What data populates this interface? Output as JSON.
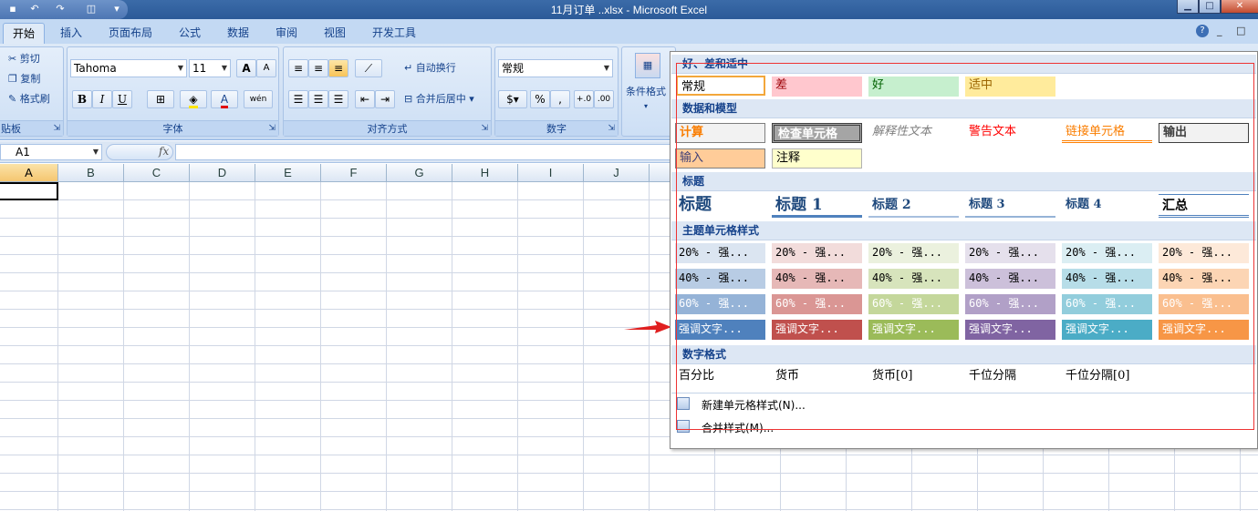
{
  "window": {
    "title": "11月订单 ..xlsx - Microsoft Excel",
    "min": "▁",
    "max": "□",
    "close": "✕"
  },
  "ribbon_tabs": [
    "开始",
    "插入",
    "页面布局",
    "公式",
    "数据",
    "审阅",
    "视图",
    "开发工具"
  ],
  "ribbon_right": {
    "help": "?",
    "min": "_",
    "restore": "□"
  },
  "clipboard": {
    "cut": "剪切",
    "copy": "复制",
    "painter": "格式刷",
    "label": "贴板"
  },
  "font": {
    "name": "Tahoma",
    "size": "11",
    "grow": "A",
    "shrink": "A",
    "bold": "B",
    "italic": "I",
    "underline": "U",
    "phonetic": "wén",
    "label": "字体"
  },
  "alignment": {
    "wrap": "自动换行",
    "merge": "合并后居中",
    "label": "对齐方式"
  },
  "number": {
    "format": "常规",
    "percent": "%",
    "comma": ",",
    "inc": "+.0",
    "dec": ".00",
    "label": "数字"
  },
  "styles": {
    "conditional": "条件格式"
  },
  "formula_bar": {
    "cell_ref": "A1",
    "fx": "fx",
    "value": ""
  },
  "columns": [
    "A",
    "B",
    "C",
    "D",
    "E",
    "F",
    "G",
    "H",
    "I",
    "J"
  ],
  "gallery": {
    "sections": [
      "好、差和适中",
      "数据和模型",
      "标题",
      "主题单元格样式",
      "数字格式"
    ],
    "good_bad": [
      "常规",
      "差",
      "好",
      "适中"
    ],
    "data_model_row1": [
      "计算",
      "检查单元格",
      "解释性文本",
      "警告文本",
      "链接单元格",
      "输出"
    ],
    "data_model_row2": [
      "输入",
      "注释"
    ],
    "headings": [
      "标题",
      "标题 1",
      "标题 2",
      "标题 3",
      "标题 4",
      "汇总"
    ],
    "theme_rows": [
      [
        "20% - 强...",
        "20% - 强...",
        "20% - 强...",
        "20% - 强...",
        "20% - 强...",
        "20% - 强..."
      ],
      [
        "40% - 强...",
        "40% - 强...",
        "40% - 强...",
        "40% - 强...",
        "40% - 强...",
        "40% - 强..."
      ],
      [
        "60% - 强...",
        "60% - 强...",
        "60% - 强...",
        "60% - 强...",
        "60% - 强...",
        "60% - 强..."
      ],
      [
        "强调文字...",
        "强调文字...",
        "强调文字...",
        "强调文字...",
        "强调文字...",
        "强调文字..."
      ]
    ],
    "number_formats": [
      "百分比",
      "货币",
      "货币[0]",
      "千位分隔",
      "千位分隔[0]"
    ],
    "menu": {
      "new_style": "新建单元格样式(N)...",
      "merge_styles": "合并样式(M)..."
    }
  },
  "colors": {
    "accent_red_arrow": "#e02020",
    "ribbon_bg": "#dde9f7"
  }
}
